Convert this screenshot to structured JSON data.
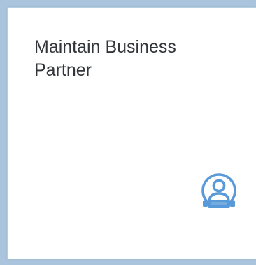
{
  "tile": {
    "title_line1": "Maintain Business",
    "title_line2": "Partner",
    "icon": "business-partner-icon",
    "icon_color": "#5899da"
  }
}
